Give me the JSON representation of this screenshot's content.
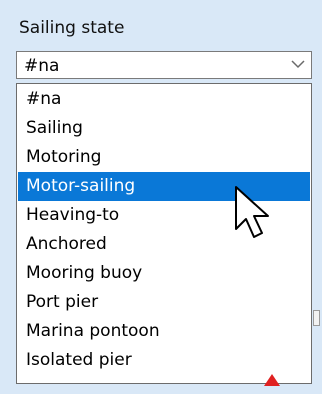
{
  "field": {
    "label": "Sailing state",
    "current_value": "#na"
  },
  "options": [
    "#na",
    "Sailing",
    "Motoring",
    "Motor-sailing",
    "Heaving-to",
    "Anchored",
    "Mooring buoy",
    "Port pier",
    "Marina pontoon",
    "Isolated pier"
  ],
  "highlighted_option": "Motor-sailing",
  "colors": {
    "panel_background": "#d9e8f7",
    "selection": "#0a78d7",
    "pointer_marker": "#e02020"
  },
  "icons": {
    "dropdown_arrow": "chevron-down-icon",
    "pointer": "mouse-pointer-icon",
    "marker": "red-triangle-icon"
  }
}
